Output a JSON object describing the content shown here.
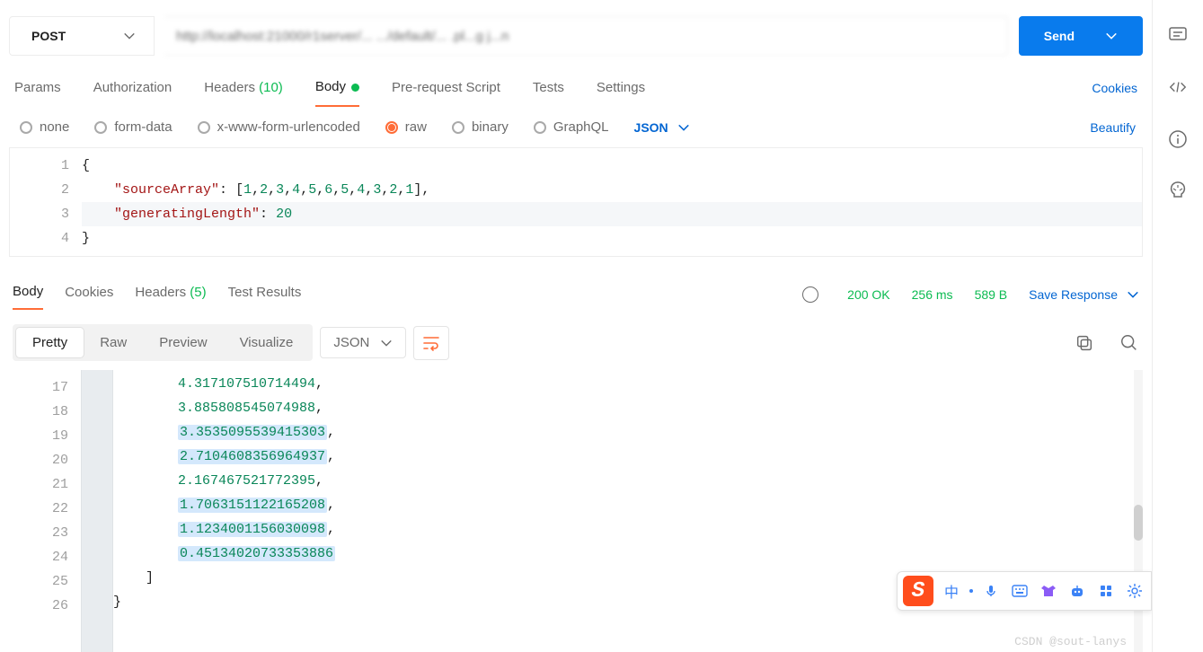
{
  "request": {
    "method": "POST",
    "url": "http://localhost:21000/r1server/...                                         .../default/...  .pl...g j...n",
    "sendLabel": "Send"
  },
  "reqTabs": {
    "params": "Params",
    "authorization": "Authorization",
    "headers": "Headers",
    "headersCount": "(10)",
    "body": "Body",
    "prerequest": "Pre-request Script",
    "tests": "Tests",
    "settings": "Settings",
    "cookies": "Cookies"
  },
  "bodyTypes": {
    "none": "none",
    "formdata": "form-data",
    "xwww": "x-www-form-urlencoded",
    "raw": "raw",
    "binary": "binary",
    "graphql": "GraphQL",
    "format": "JSON",
    "beautify": "Beautify"
  },
  "reqBody": {
    "ln1": "{",
    "ln2_key": "\"sourceArray\"",
    "ln2_vals": "[1,2,3,4,5,6,5,4,3,2,1]",
    "ln3_key": "\"generatingLength\"",
    "ln3_val": "20",
    "ln4": "}"
  },
  "response": {
    "tabs": {
      "body": "Body",
      "cookies": "Cookies",
      "headers": "Headers",
      "headersCount": "(5)",
      "testResults": "Test Results"
    },
    "status": "200 OK",
    "time": "256 ms",
    "size": "589 B",
    "save": "Save Response",
    "viewModes": {
      "pretty": "Pretty",
      "raw": "Raw",
      "preview": "Preview",
      "visualize": "Visualize"
    },
    "format": "JSON",
    "lines": {
      "n17": "17",
      "v17": "4.317107510714494",
      "n18": "18",
      "v18": "3.885808545074988",
      "n19": "19",
      "v19": "3.3535095539415303",
      "n20": "20",
      "v20": "2.7104608356964937",
      "n21": "21",
      "v21": "2.167467521772395",
      "n22": "22",
      "v22": "1.7063151122165208",
      "n23": "23",
      "v23": "1.1234001156030098",
      "n24": "24",
      "v24": "0.45134020733353886",
      "n25": "25",
      "n26": "26"
    }
  },
  "watermark": "CSDN @sout-lanys",
  "ime": {
    "cn": "中"
  }
}
